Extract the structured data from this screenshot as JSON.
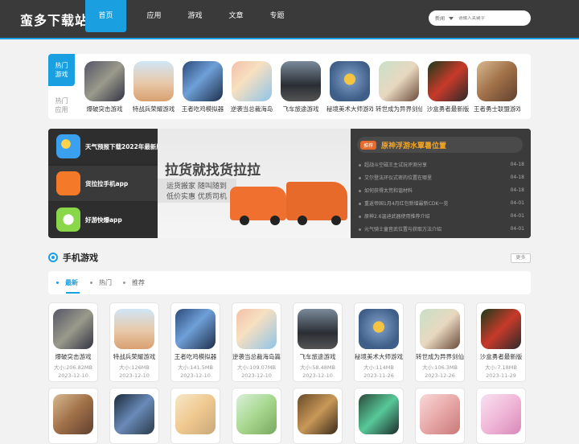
{
  "header": {
    "logo": "蛮多下载站",
    "nav": [
      "首页",
      "应用",
      "游戏",
      "文章",
      "专题"
    ],
    "search": {
      "type": "新闻",
      "placeholder": "请输入关键字"
    }
  },
  "hot": {
    "tabs": [
      {
        "label": "热门游戏"
      },
      {
        "label": "热门应用"
      }
    ],
    "apps": [
      {
        "name": "爆破突击游戏"
      },
      {
        "name": "特战兵荣耀游戏"
      },
      {
        "name": "王者吃鸡模拟器"
      },
      {
        "name": "逆袭当总裁海岛"
      },
      {
        "name": "飞车旅途游戏"
      },
      {
        "name": "秘境美术大师游戏"
      },
      {
        "name": "转世成为异界剑仙"
      },
      {
        "name": "沙盒勇者最新版"
      },
      {
        "name": "王者勇士联盟游戏"
      }
    ]
  },
  "banner": {
    "left": [
      {
        "label": "天气预报下载2022年最新版"
      },
      {
        "label": "货拉拉手机app"
      },
      {
        "label": "好游快爆app"
      }
    ],
    "ad": {
      "title": "拉货就找货拉拉",
      "line1": "运货搬家  随叫随到",
      "line2": "低价实惠  优质司机"
    },
    "news": {
      "tag": "推荐",
      "headline": "原神浮游水覃暑位置",
      "items": [
        {
          "title": "超战斗空磁王主试玩评测分享",
          "date": "04-18"
        },
        {
          "title": "艾尔登法环仪式密的位置在哪里",
          "date": "04-18"
        },
        {
          "title": "如何获得太荒和谐材料",
          "date": "04-18"
        },
        {
          "title": "重返帝国1月4月红包新增最新CDK一览",
          "date": "04-01"
        },
        {
          "title": "原神2.6温迪武器使用推荐介绍",
          "date": "04-01"
        },
        {
          "title": "元气骑士童音武位置与获取方法介绍",
          "date": "04-01"
        }
      ]
    }
  },
  "section": {
    "title": "手机游戏",
    "more": "更多"
  },
  "tabs": [
    "最新",
    "热门",
    "推荐"
  ],
  "games": [
    {
      "name": "爆破突击游戏",
      "size": "大小:206.82MB",
      "date": "2023-12-10"
    },
    {
      "name": "特战兵荣耀游戏",
      "size": "大小:126MB",
      "date": "2023-12-10"
    },
    {
      "name": "王者吃鸡模拟器",
      "size": "大小:141.5MB",
      "date": "2023-12-10"
    },
    {
      "name": "逆袭当总裁海岛篇",
      "size": "大小:109.07MB",
      "date": "2023-12-10"
    },
    {
      "name": "飞车旅途游戏",
      "size": "大小:58.48MB",
      "date": "2023-12-10"
    },
    {
      "name": "秘境美术大师游戏",
      "size": "大小:114MB",
      "date": "2023-11-26"
    },
    {
      "name": "转世成为异界剑仙游",
      "size": "大小:106.3MB",
      "date": "2023-12-26"
    },
    {
      "name": "沙盒勇者最新版",
      "size": "大小:7.18MB",
      "date": "2023-11-29"
    }
  ]
}
